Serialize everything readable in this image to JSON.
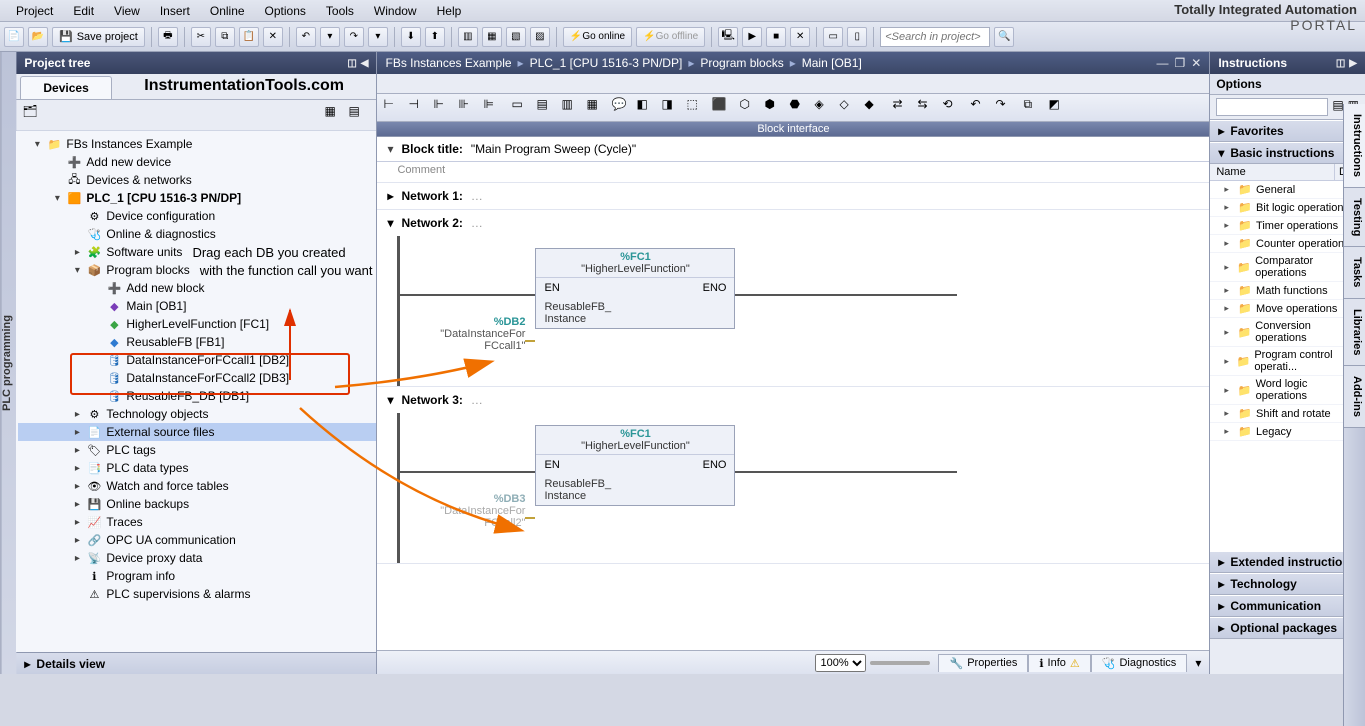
{
  "brand": {
    "line1": "Totally Integrated Automation",
    "line2": "PORTAL"
  },
  "menu": {
    "project": "Project",
    "edit": "Edit",
    "view": "View",
    "insert": "Insert",
    "online": "Online",
    "options": "Options",
    "tools": "Tools",
    "window": "Window",
    "help": "Help"
  },
  "toolbar": {
    "saveProject": "Save project",
    "goOnline": "Go online",
    "goOffline": "Go offline",
    "searchPlaceholder": "<Search in project>"
  },
  "siderail": {
    "label": "PLC programming"
  },
  "projecttree": {
    "title": "Project tree",
    "devicesTab": "Devices",
    "overlay": "InstrumentationTools.com",
    "nodes": {
      "root": "FBs Instances Example",
      "addDevice": "Add new device",
      "devNet": "Devices & networks",
      "plc": "PLC_1 [CPU 1516-3 PN/DP]",
      "devConfig": "Device configuration",
      "onlineDiag": "Online & diagnostics",
      "swUnits": "Software units",
      "progBlocks": "Program blocks",
      "addBlock": "Add new block",
      "main": "Main [OB1]",
      "fc1": "HigherLevelFunction [FC1]",
      "fb1": "ReusableFB [FB1]",
      "db2": "DataInstanceForFCcall1 [DB2]",
      "db3": "DataInstanceForFCcall2 [DB3]",
      "db1": "ReusableFB_DB [DB1]",
      "techObj": "Technology objects",
      "extSrc": "External source files",
      "plcTags": "PLC tags",
      "plcDT": "PLC data types",
      "watch": "Watch and force tables",
      "backups": "Online backups",
      "traces": "Traces",
      "opcua": "OPC UA communication",
      "proxy": "Device proxy data",
      "progInfo": "Program info",
      "superv": "PLC supervisions & alarms"
    },
    "detailsView": "Details view",
    "annot1": "Drag each DB you created",
    "annot2": "with the function call you want"
  },
  "breadcrumb": {
    "p1": "FBs Instances Example",
    "p2": "PLC_1 [CPU 1516-3 PN/DP]",
    "p3": "Program blocks",
    "p4": "Main [OB1]"
  },
  "editor": {
    "blockInterface": "Block interface",
    "blockTitleLabel": "Block title:",
    "blockTitleValue": "\"Main Program Sweep (Cycle)\"",
    "comment": "Comment",
    "network1": "Network 1:",
    "network2": "Network 2:",
    "network3": "Network 3:",
    "fc": {
      "sym": "%FC1",
      "name": "\"HigherLevelFunction\"",
      "en": "EN",
      "eno": "ENO",
      "paramLabel": "ReusableFB_",
      "paramLabel2": "Instance"
    },
    "db2": {
      "sym": "%DB2",
      "name": "\"DataInstanceFor",
      "name2": "FCcall1\""
    },
    "db3": {
      "sym": "%DB3",
      "name": "\"DataInstanceFor",
      "name2": "FCcall2\""
    },
    "zoom": "100%"
  },
  "footerTabs": {
    "properties": "Properties",
    "info": "Info",
    "diagnostics": "Diagnostics"
  },
  "right": {
    "title": "Instructions",
    "options": "Options",
    "favorites": "Favorites",
    "basic": "Basic instructions",
    "thName": "Name",
    "thDesc": "De...",
    "rows": {
      "general": "General",
      "bit": "Bit logic operations",
      "timer": "Timer operations",
      "counter": "Counter operations",
      "comp": "Comparator operations",
      "math": "Math functions",
      "move": "Move operations",
      "conv": "Conversion operations",
      "progctrl": "Program control operati...",
      "word": "Word logic operations",
      "shift": "Shift and rotate",
      "legacy": "Legacy"
    },
    "ext": "Extended instructions",
    "tech": "Technology",
    "comm": "Communication",
    "optpkg": "Optional packages"
  },
  "rightRail": {
    "instructions": "Instructions",
    "testing": "Testing",
    "tasks": "Tasks",
    "libraries": "Libraries",
    "addins": "Add-ins"
  }
}
